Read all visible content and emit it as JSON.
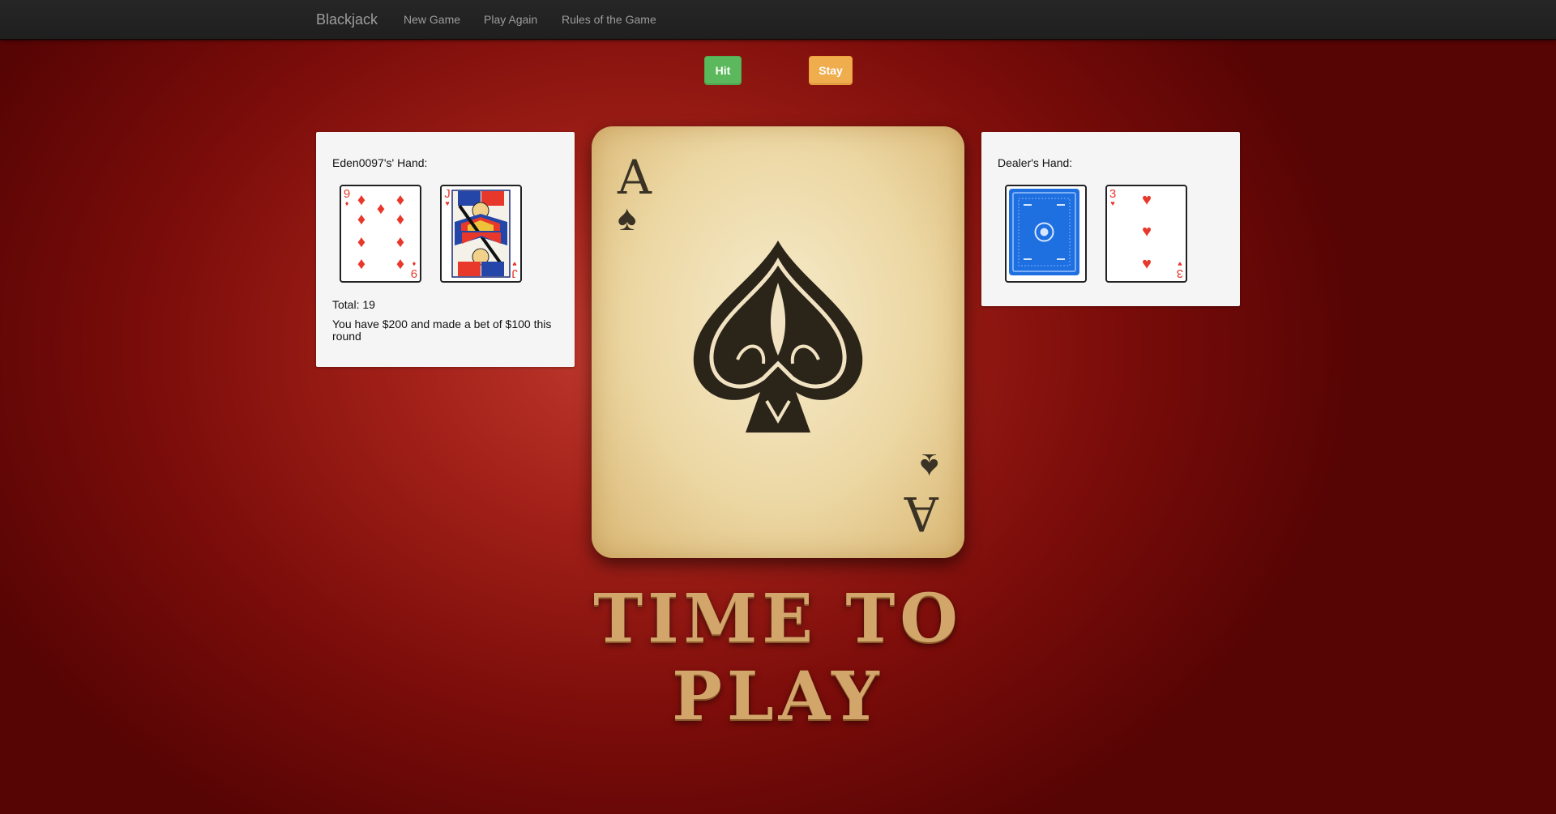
{
  "nav": {
    "brand": "Blackjack",
    "links": [
      "New Game",
      "Play Again",
      "Rules of the Game"
    ]
  },
  "actions": {
    "hit": "Hit",
    "stay": "Stay"
  },
  "player": {
    "title": "Eden0097's' Hand:",
    "cards": [
      {
        "rank": "9",
        "suit": "diamonds",
        "suit_symbol": "♦"
      },
      {
        "rank": "J",
        "suit": "hearts",
        "suit_symbol": "♥"
      }
    ],
    "total": "Total: 19",
    "bet_text": "You have $200 and made a bet of $100 this round"
  },
  "dealer": {
    "title": "Dealer's Hand:",
    "cards": [
      {
        "face": "down"
      },
      {
        "rank": "3",
        "suit": "hearts",
        "suit_symbol": "♥"
      }
    ]
  },
  "hero": {
    "card_rank": "A",
    "card_suit_symbol": "♠",
    "headline": "TIME TO PLAY"
  },
  "colors": {
    "hit_button": "#5cb85c",
    "stay_button": "#f0ad4e",
    "card_red": "#e8382b",
    "card_back_blue": "#1e6fe0"
  }
}
